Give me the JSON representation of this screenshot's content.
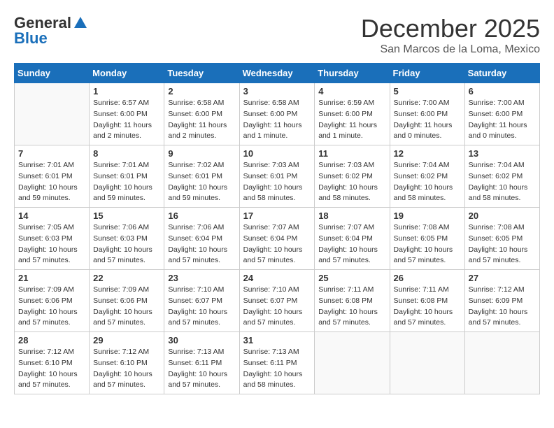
{
  "logo": {
    "general": "General",
    "blue": "Blue"
  },
  "title": "December 2025",
  "location": "San Marcos de la Loma, Mexico",
  "days_of_week": [
    "Sunday",
    "Monday",
    "Tuesday",
    "Wednesday",
    "Thursday",
    "Friday",
    "Saturday"
  ],
  "weeks": [
    [
      {
        "day": "",
        "info": ""
      },
      {
        "day": "1",
        "info": "Sunrise: 6:57 AM\nSunset: 6:00 PM\nDaylight: 11 hours\nand 2 minutes."
      },
      {
        "day": "2",
        "info": "Sunrise: 6:58 AM\nSunset: 6:00 PM\nDaylight: 11 hours\nand 2 minutes."
      },
      {
        "day": "3",
        "info": "Sunrise: 6:58 AM\nSunset: 6:00 PM\nDaylight: 11 hours\nand 1 minute."
      },
      {
        "day": "4",
        "info": "Sunrise: 6:59 AM\nSunset: 6:00 PM\nDaylight: 11 hours\nand 1 minute."
      },
      {
        "day": "5",
        "info": "Sunrise: 7:00 AM\nSunset: 6:00 PM\nDaylight: 11 hours\nand 0 minutes."
      },
      {
        "day": "6",
        "info": "Sunrise: 7:00 AM\nSunset: 6:00 PM\nDaylight: 11 hours\nand 0 minutes."
      }
    ],
    [
      {
        "day": "7",
        "info": "Sunrise: 7:01 AM\nSunset: 6:01 PM\nDaylight: 10 hours\nand 59 minutes."
      },
      {
        "day": "8",
        "info": "Sunrise: 7:01 AM\nSunset: 6:01 PM\nDaylight: 10 hours\nand 59 minutes."
      },
      {
        "day": "9",
        "info": "Sunrise: 7:02 AM\nSunset: 6:01 PM\nDaylight: 10 hours\nand 59 minutes."
      },
      {
        "day": "10",
        "info": "Sunrise: 7:03 AM\nSunset: 6:01 PM\nDaylight: 10 hours\nand 58 minutes."
      },
      {
        "day": "11",
        "info": "Sunrise: 7:03 AM\nSunset: 6:02 PM\nDaylight: 10 hours\nand 58 minutes."
      },
      {
        "day": "12",
        "info": "Sunrise: 7:04 AM\nSunset: 6:02 PM\nDaylight: 10 hours\nand 58 minutes."
      },
      {
        "day": "13",
        "info": "Sunrise: 7:04 AM\nSunset: 6:02 PM\nDaylight: 10 hours\nand 58 minutes."
      }
    ],
    [
      {
        "day": "14",
        "info": "Sunrise: 7:05 AM\nSunset: 6:03 PM\nDaylight: 10 hours\nand 57 minutes."
      },
      {
        "day": "15",
        "info": "Sunrise: 7:06 AM\nSunset: 6:03 PM\nDaylight: 10 hours\nand 57 minutes."
      },
      {
        "day": "16",
        "info": "Sunrise: 7:06 AM\nSunset: 6:04 PM\nDaylight: 10 hours\nand 57 minutes."
      },
      {
        "day": "17",
        "info": "Sunrise: 7:07 AM\nSunset: 6:04 PM\nDaylight: 10 hours\nand 57 minutes."
      },
      {
        "day": "18",
        "info": "Sunrise: 7:07 AM\nSunset: 6:04 PM\nDaylight: 10 hours\nand 57 minutes."
      },
      {
        "day": "19",
        "info": "Sunrise: 7:08 AM\nSunset: 6:05 PM\nDaylight: 10 hours\nand 57 minutes."
      },
      {
        "day": "20",
        "info": "Sunrise: 7:08 AM\nSunset: 6:05 PM\nDaylight: 10 hours\nand 57 minutes."
      }
    ],
    [
      {
        "day": "21",
        "info": "Sunrise: 7:09 AM\nSunset: 6:06 PM\nDaylight: 10 hours\nand 57 minutes."
      },
      {
        "day": "22",
        "info": "Sunrise: 7:09 AM\nSunset: 6:06 PM\nDaylight: 10 hours\nand 57 minutes."
      },
      {
        "day": "23",
        "info": "Sunrise: 7:10 AM\nSunset: 6:07 PM\nDaylight: 10 hours\nand 57 minutes."
      },
      {
        "day": "24",
        "info": "Sunrise: 7:10 AM\nSunset: 6:07 PM\nDaylight: 10 hours\nand 57 minutes."
      },
      {
        "day": "25",
        "info": "Sunrise: 7:11 AM\nSunset: 6:08 PM\nDaylight: 10 hours\nand 57 minutes."
      },
      {
        "day": "26",
        "info": "Sunrise: 7:11 AM\nSunset: 6:08 PM\nDaylight: 10 hours\nand 57 minutes."
      },
      {
        "day": "27",
        "info": "Sunrise: 7:12 AM\nSunset: 6:09 PM\nDaylight: 10 hours\nand 57 minutes."
      }
    ],
    [
      {
        "day": "28",
        "info": "Sunrise: 7:12 AM\nSunset: 6:10 PM\nDaylight: 10 hours\nand 57 minutes."
      },
      {
        "day": "29",
        "info": "Sunrise: 7:12 AM\nSunset: 6:10 PM\nDaylight: 10 hours\nand 57 minutes."
      },
      {
        "day": "30",
        "info": "Sunrise: 7:13 AM\nSunset: 6:11 PM\nDaylight: 10 hours\nand 57 minutes."
      },
      {
        "day": "31",
        "info": "Sunrise: 7:13 AM\nSunset: 6:11 PM\nDaylight: 10 hours\nand 58 minutes."
      },
      {
        "day": "",
        "info": ""
      },
      {
        "day": "",
        "info": ""
      },
      {
        "day": "",
        "info": ""
      }
    ]
  ]
}
